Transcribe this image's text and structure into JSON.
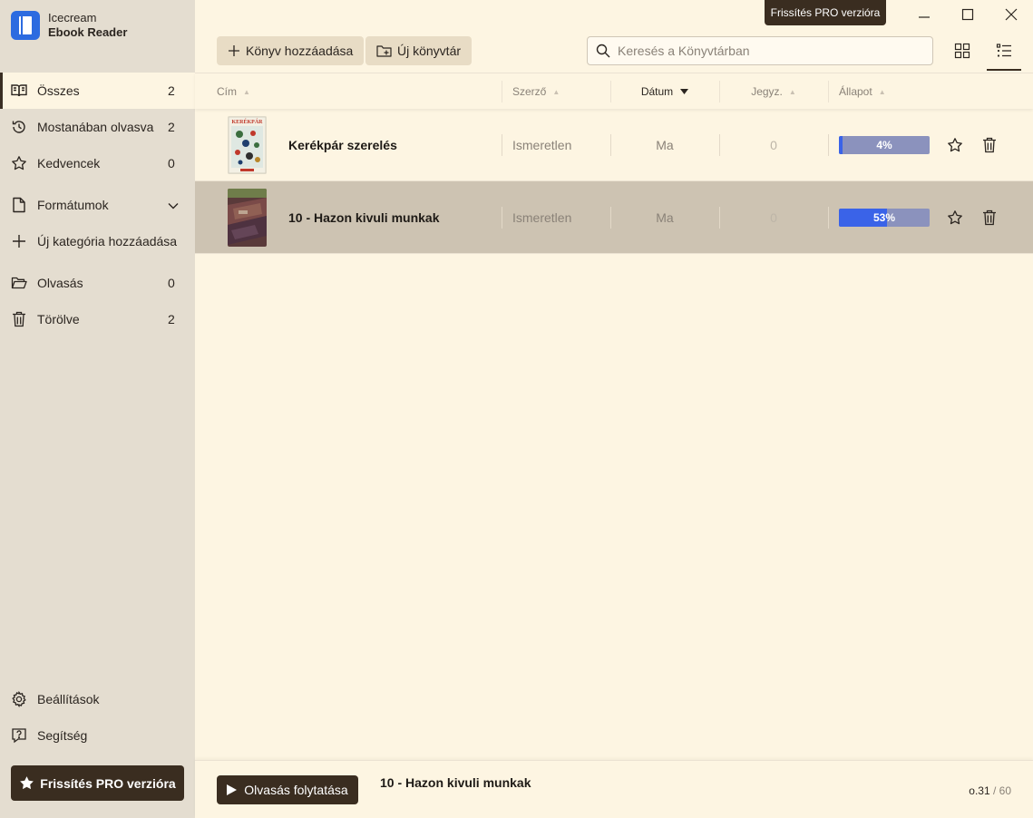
{
  "app": {
    "name_line1": "Icecream",
    "name_line2": "Ebook Reader"
  },
  "sidebar": {
    "items": [
      {
        "label": "Összes",
        "count": "2",
        "icon": "book-open-icon"
      },
      {
        "label": "Mostanában olvasva",
        "count": "2",
        "icon": "history-icon"
      },
      {
        "label": "Kedvencek",
        "count": "0",
        "icon": "star-icon"
      },
      {
        "label": "Formátumok",
        "icon": "file-icon"
      },
      {
        "label": "Új kategória hozzáadása",
        "icon": "plus-icon"
      },
      {
        "label": "Olvasás",
        "count": "0",
        "icon": "folder-open-icon"
      },
      {
        "label": "Törölve",
        "count": "2",
        "icon": "trash-icon"
      }
    ],
    "settings_label": "Beállítások",
    "help_label": "Segítség",
    "pro_button": "Frissítés PRO verzióra"
  },
  "topbar": {
    "pro_tooltip": "Frissítés PRO verzióra",
    "add_book": "Könyv hozzáadása",
    "new_library": "Új könyvtár",
    "search_placeholder": "Keresés a Könyvtárban"
  },
  "table": {
    "headers": {
      "title": "Cím",
      "author": "Szerző",
      "date": "Dátum",
      "notes": "Jegyz.",
      "status": "Állapot"
    },
    "rows": [
      {
        "title": "Kerékpár szerelés",
        "author": "Ismeretlen",
        "date": "Ma",
        "notes": "0",
        "progress_text": "4%",
        "progress": 4,
        "cover_label": "KERÉKPÁR"
      },
      {
        "title": "10 - Hazon kivuli munkak",
        "author": "Ismeretlen",
        "date": "Ma",
        "notes": "0",
        "progress_text": "53%",
        "progress": 53
      }
    ]
  },
  "footer": {
    "continue_label": "Olvasás folytatása",
    "current_title": "10 - Hazon kivuli munkak",
    "page_current": "o.31",
    "page_total": " / 60"
  },
  "colors": {
    "accent": "#3a2d20",
    "progress": "#3a63e8",
    "logo": "#2c6be0"
  }
}
